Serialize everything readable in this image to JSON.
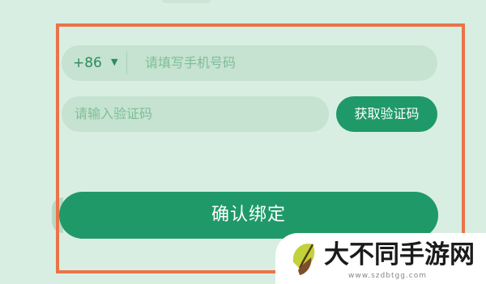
{
  "form": {
    "country_code": "+86",
    "dropdown_caret": "▼",
    "phone_placeholder": "请填写手机号码",
    "code_placeholder": "请输入验证码",
    "get_code_label": "获取验证码",
    "confirm_label": "确认绑定"
  },
  "watermark": {
    "text": "大不同手游网",
    "url": "www.szdbtgg.com"
  },
  "colors": {
    "background": "#d9eee2",
    "field_fill": "#c6e2d0",
    "primary_green": "#1f9968",
    "highlight_frame": "#ea7448",
    "placeholder_text": "#7cbf98"
  },
  "icons": {
    "dropdown": "chevron-down-icon",
    "watermark_logo": "leaf-logo-icon"
  }
}
